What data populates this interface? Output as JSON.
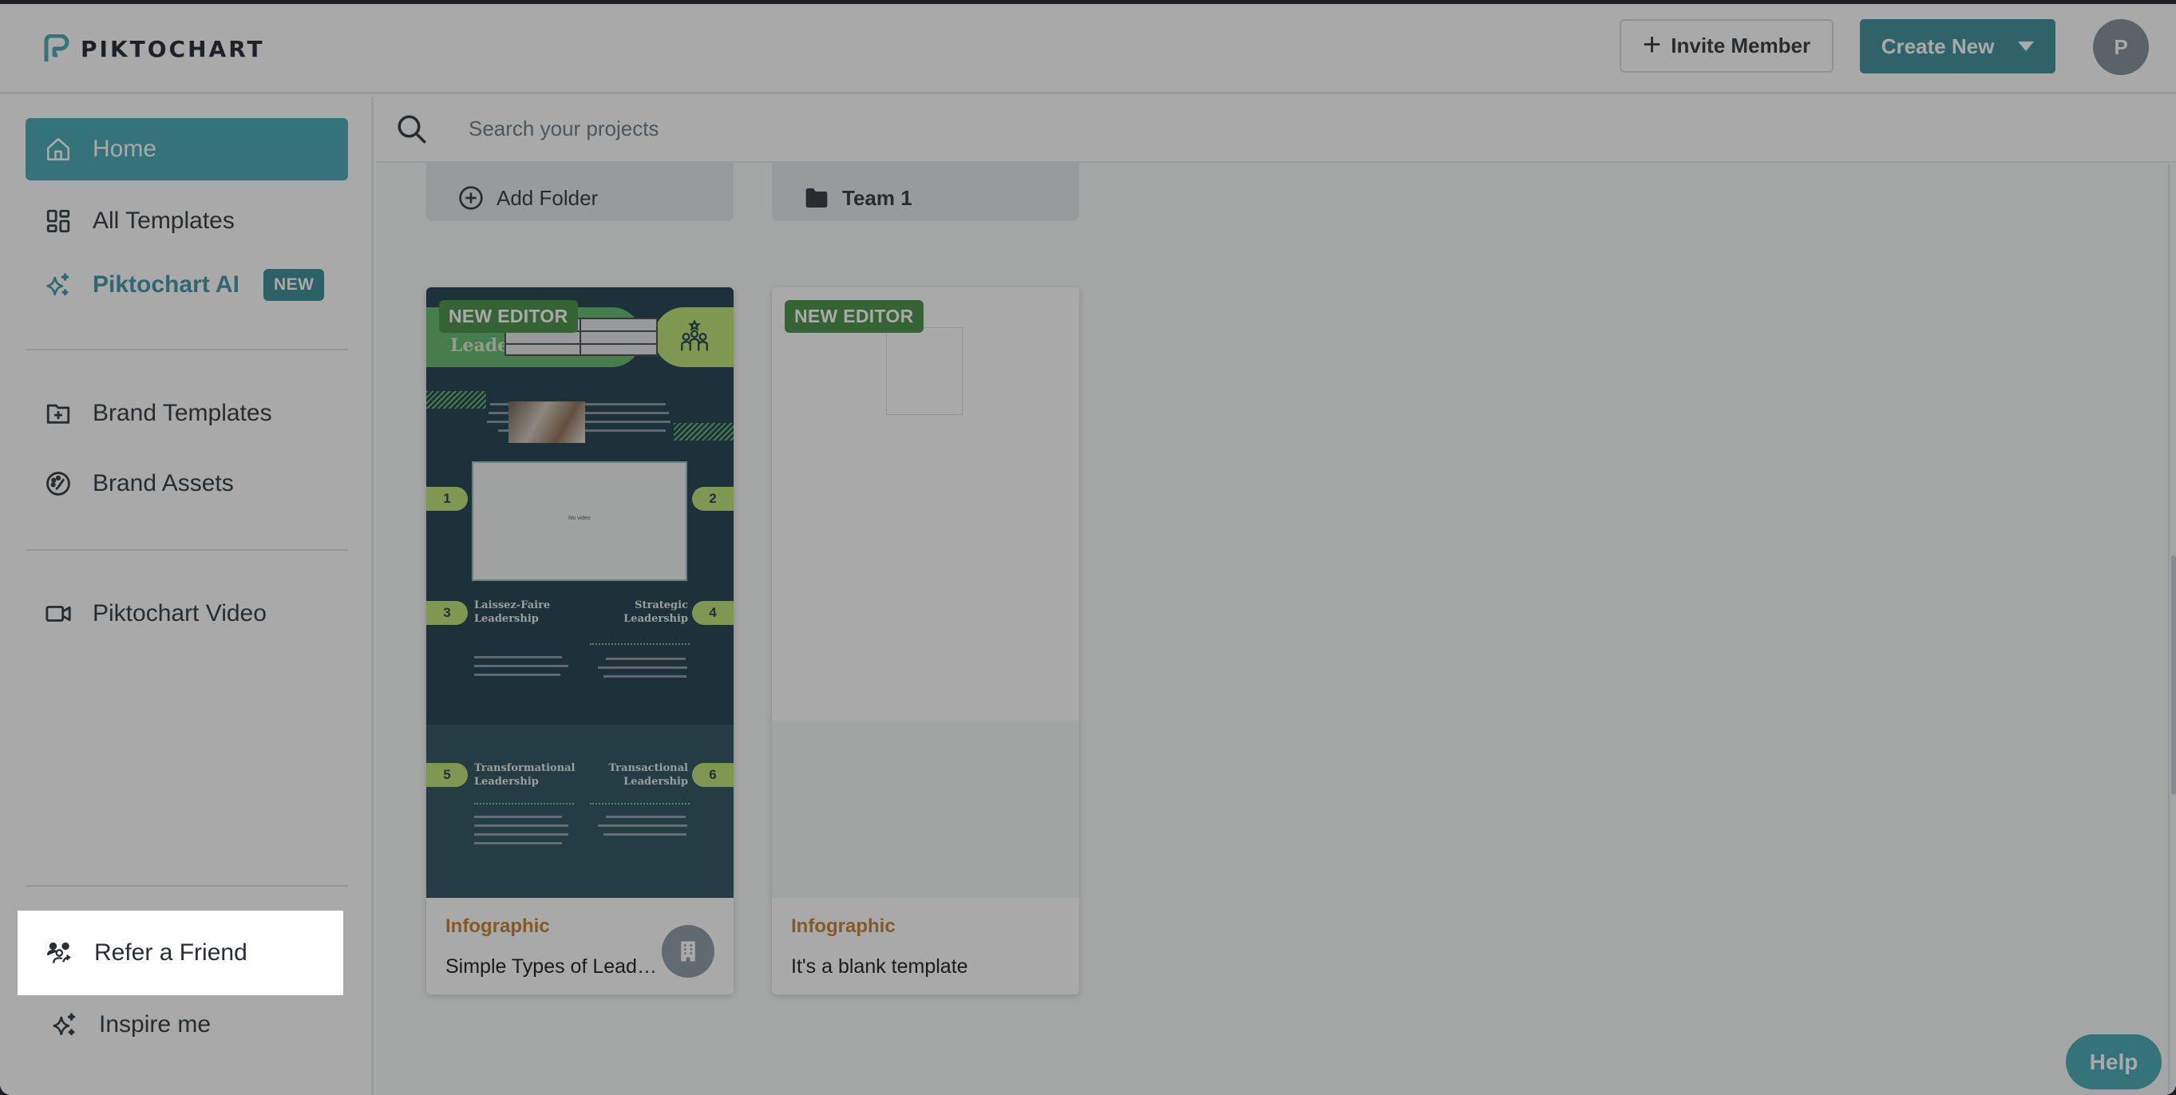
{
  "brand": {
    "name": "PIKTOCHART"
  },
  "header": {
    "invite_label": "Invite Member",
    "create_label": "Create New",
    "avatar_initial": "P"
  },
  "sidebar": {
    "items": [
      {
        "label": "Home",
        "icon": "home-icon",
        "active": true
      },
      {
        "label": "All Templates",
        "icon": "grid-icon"
      },
      {
        "label": "Piktochart AI",
        "icon": "sparkle-icon",
        "badge": "NEW"
      },
      {
        "label": "Brand Templates",
        "icon": "folder-plus-icon"
      },
      {
        "label": "Brand Assets",
        "icon": "palette-icon"
      },
      {
        "label": "Piktochart Video",
        "icon": "video-icon"
      },
      {
        "label": "Refer a Friend",
        "icon": "refer-friend-icon",
        "highlighted": true
      },
      {
        "label": "Inspire me",
        "icon": "sparkle-icon"
      }
    ]
  },
  "search": {
    "placeholder": "Search your projects"
  },
  "folders": [
    {
      "label": "Add Folder",
      "icon": "plus-circle-icon"
    },
    {
      "label": "Team 1",
      "icon": "folder-icon"
    }
  ],
  "projects": [
    {
      "badge": "NEW EDITOR",
      "type": "Infographic",
      "title": "Simple Types of Leadership",
      "owner_icon": "building-icon",
      "thumbnail": {
        "heading": "Leader",
        "video_placeholder": "No video",
        "sections": [
          {
            "num": "1"
          },
          {
            "num": "2"
          },
          {
            "num": "3",
            "title": "Laissez-Faire Leadership"
          },
          {
            "num": "4",
            "title": "Strategic Leadership"
          },
          {
            "num": "5",
            "title": "Transformational Leadership"
          },
          {
            "num": "6",
            "title": "Transactional Leadership"
          }
        ]
      }
    },
    {
      "badge": "NEW EDITOR",
      "type": "Infographic",
      "title": "It's a blank template"
    }
  ],
  "help_label": "Help",
  "colors": {
    "accent": "#3ba5b0",
    "badge_green": "#3f8b3c",
    "type_label": "#c47a22"
  }
}
